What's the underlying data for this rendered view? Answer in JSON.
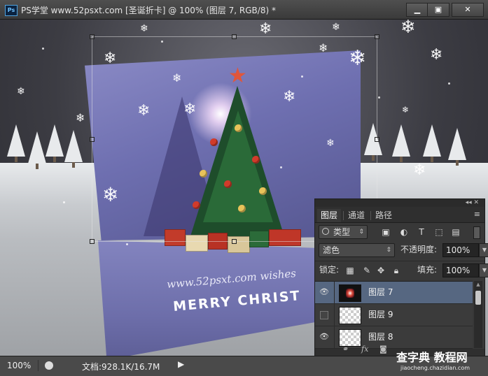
{
  "window": {
    "title": "PS学堂 www.52psxt.com [圣诞折卡] @ 100% (图层 7, RGB/8) *",
    "app_icon": "Ps",
    "minimize_icon": "minimize-icon",
    "maximize_icon": "maximize-icon",
    "close_icon": "close-icon"
  },
  "canvas": {
    "card_url": "www.52psxt.com wishes",
    "card_message": "MERRY CHRIST"
  },
  "layers_panel": {
    "tabs": [
      "图层",
      "通道",
      "路径"
    ],
    "active_tab": "图层",
    "filter_label": "类型",
    "blend_mode": "滤色",
    "opacity_label": "不透明度:",
    "opacity_value": "100%",
    "lock_label": "锁定:",
    "fill_label": "填充:",
    "fill_value": "100%",
    "layers": [
      {
        "name": "图层 7",
        "visible": true,
        "selected": true
      },
      {
        "name": "图层 9",
        "visible": false,
        "selected": false
      },
      {
        "name": "图层 8",
        "visible": true,
        "selected": false
      }
    ],
    "footer": {
      "fx": "fx"
    }
  },
  "status_bar": {
    "zoom": "100%",
    "doc_info": "文档:928.1K/16.7M"
  },
  "watermark": {
    "main": "查字典 教程网",
    "url": "jiaocheng.chazidian.com"
  }
}
